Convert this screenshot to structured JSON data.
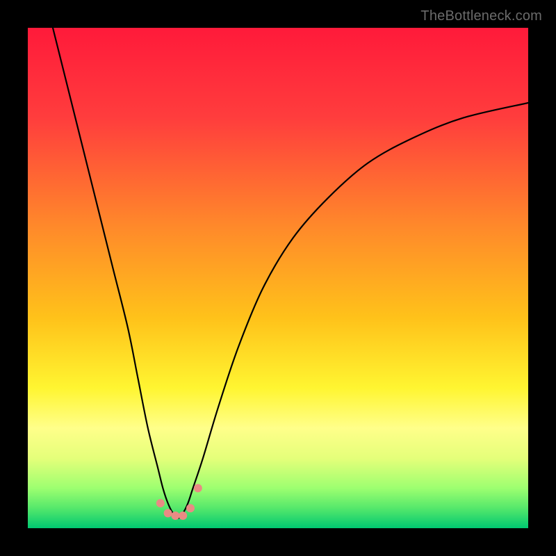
{
  "watermark": "TheBottleneck.com",
  "chart_data": {
    "type": "line",
    "title": "",
    "xlabel": "",
    "ylabel": "",
    "xlim": [
      0,
      100
    ],
    "ylim": [
      0,
      100
    ],
    "grid": false,
    "legend": false,
    "background_gradient_stops": [
      {
        "offset": 0.0,
        "color": "#ff1a3a"
      },
      {
        "offset": 0.18,
        "color": "#ff3d3d"
      },
      {
        "offset": 0.4,
        "color": "#ff8a2a"
      },
      {
        "offset": 0.58,
        "color": "#ffc21a"
      },
      {
        "offset": 0.72,
        "color": "#fff531"
      },
      {
        "offset": 0.8,
        "color": "#ffff8a"
      },
      {
        "offset": 0.86,
        "color": "#e5ff7a"
      },
      {
        "offset": 0.92,
        "color": "#9dff70"
      },
      {
        "offset": 0.96,
        "color": "#55e86b"
      },
      {
        "offset": 1.0,
        "color": "#00c871"
      }
    ],
    "series": [
      {
        "name": "bottleneck-curve",
        "color": "#000000",
        "x": [
          5,
          8,
          11,
          14,
          17,
          20,
          22,
          24,
          26,
          27,
          28,
          29,
          30,
          31,
          32,
          33,
          35,
          38,
          42,
          47,
          53,
          60,
          68,
          77,
          87,
          100
        ],
        "values": [
          100,
          88,
          76,
          64,
          52,
          40,
          30,
          20,
          12,
          8,
          5,
          3,
          2,
          3,
          5,
          8,
          14,
          24,
          36,
          48,
          58,
          66,
          73,
          78,
          82,
          85
        ]
      }
    ],
    "markers": {
      "name": "highlight-dots",
      "color": "#e98b84",
      "radius": 6,
      "x": [
        26.5,
        28.0,
        29.5,
        31.0,
        32.5,
        34.0
      ],
      "values": [
        5.0,
        3.0,
        2.5,
        2.5,
        4.0,
        8.0
      ]
    }
  }
}
